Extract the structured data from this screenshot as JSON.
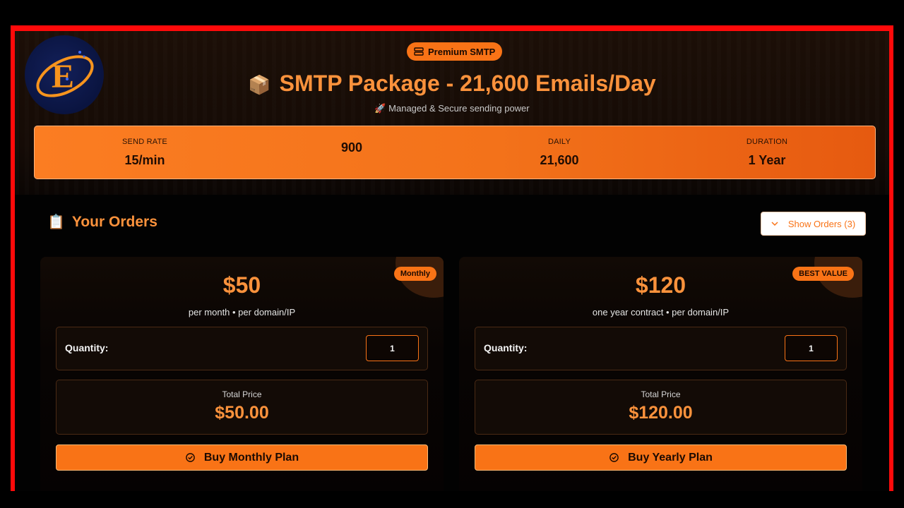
{
  "header": {
    "badge": "Premium SMTP",
    "title_emoji": "📦",
    "title": "SMTP Package - 21,600 Emails/Day",
    "subtitle": "🚀 Managed & Secure sending power"
  },
  "stats": [
    {
      "label": "SEND RATE",
      "value": "15/min"
    },
    {
      "label": "",
      "value": "900"
    },
    {
      "label": "DAILY",
      "value": "21,600"
    },
    {
      "label": "DURATION",
      "value": "1 Year"
    }
  ],
  "orders": {
    "emoji": "📋",
    "title": "Your Orders",
    "show_button": "Show Orders (3)"
  },
  "plans": [
    {
      "tag": "Monthly",
      "price": "$50",
      "per": "per month • per domain/IP",
      "quantity_label": "Quantity:",
      "quantity": "1",
      "total_label": "Total Price",
      "total": "$50.00",
      "buy_label": "Buy Monthly Plan"
    },
    {
      "tag": "BEST VALUE",
      "price": "$120",
      "per": "one year contract • per domain/IP",
      "quantity_label": "Quantity:",
      "quantity": "1",
      "total_label": "Total Price",
      "total": "$120.00",
      "buy_label": "Buy Yearly Plan"
    }
  ],
  "colors": {
    "accent": "#f97316",
    "accent_text": "#fb923c",
    "frame": "#ff0a0a",
    "background": "#020202"
  },
  "icons": [
    "logo-e",
    "server-icon",
    "chevron-down-icon",
    "check-circle-icon"
  ]
}
